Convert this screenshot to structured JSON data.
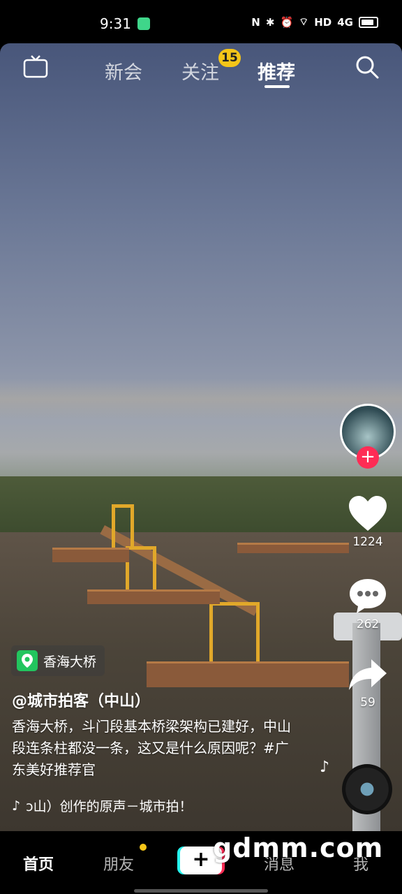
{
  "status_bar": {
    "time": "9:31",
    "network": "HD",
    "signal": "4G"
  },
  "top_nav": {
    "live_icon": "live-tv-icon",
    "tabs": [
      {
        "label": "新会",
        "active": false
      },
      {
        "label": "关注",
        "active": false,
        "badge": "15"
      },
      {
        "label": "推荐",
        "active": true
      }
    ],
    "search_icon": "search-icon"
  },
  "side_actions": {
    "likes": "1224",
    "comments": "262",
    "shares": "59"
  },
  "video_info": {
    "location": "香海大桥",
    "author": "@城市拍客（中山）",
    "description": "香海大桥，斗门段基本桥梁架构已建好，中山段连条柱都没一条，这又是什么原因呢？#广东美好推荐官",
    "music": "ɔ山）创作的原声－城市拍！"
  },
  "bottom_nav": {
    "home": "首页",
    "friends": "朋友",
    "create": "+",
    "messages": "消息",
    "me": "我"
  },
  "watermark": "gdmm.com",
  "colors": {
    "accent": "#fe2c55",
    "badge": "#f5c518",
    "location": "#22c55e"
  }
}
